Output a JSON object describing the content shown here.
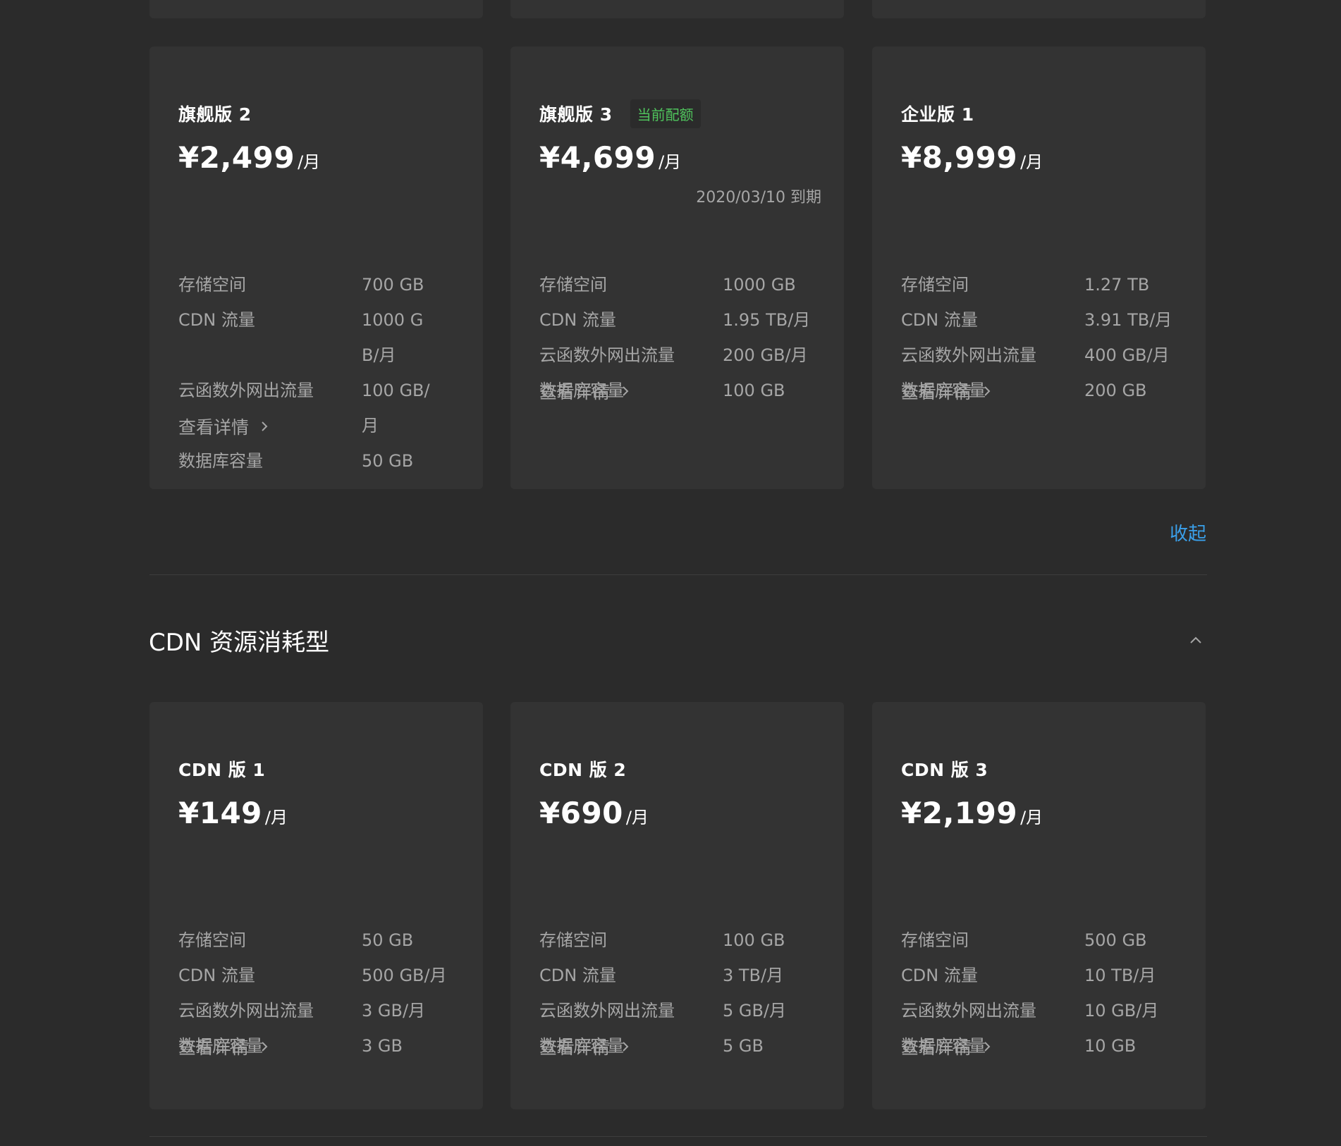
{
  "collapse_label": "收起",
  "section": {
    "title": "CDN 资源消耗型"
  },
  "spec_labels": {
    "storage": "存储空间",
    "cdn": "CDN 流量",
    "egress": "云函数外网出流量",
    "db": "数据库容量"
  },
  "details_label": "查看详情",
  "top_cards": [
    {
      "title": "旗舰版 2",
      "price": "¥2,499",
      "unit": "/月",
      "storage": "700 GB",
      "cdn": "1000 GB/月",
      "egress": "100 GB/月",
      "db": "50 GB"
    },
    {
      "title": "旗舰版 3",
      "badge": "当前配额",
      "price": "¥4,699",
      "unit": "/月",
      "expiry": "2020/03/10 到期",
      "storage": "1000 GB",
      "cdn": "1.95 TB/月",
      "egress": "200 GB/月",
      "db": "100 GB"
    },
    {
      "title": "企业版 1",
      "price": "¥8,999",
      "unit": "/月",
      "storage": "1.27 TB",
      "cdn": "3.91 TB/月",
      "egress": "400 GB/月",
      "db": "200 GB"
    }
  ],
  "cdn_cards": [
    {
      "title": "CDN 版 1",
      "price": "¥149",
      "unit": "/月",
      "storage": "50 GB",
      "cdn": "500 GB/月",
      "egress": "3 GB/月",
      "db": "3 GB"
    },
    {
      "title": "CDN 版 2",
      "price": "¥690",
      "unit": "/月",
      "storage": "100 GB",
      "cdn": "3 TB/月",
      "egress": "5 GB/月",
      "db": "5 GB"
    },
    {
      "title": "CDN 版 3",
      "price": "¥2,199",
      "unit": "/月",
      "storage": "500 GB",
      "cdn": "10 TB/月",
      "egress": "10 GB/月",
      "db": "10 GB"
    }
  ],
  "colors": {
    "background": "#2b2b2b",
    "card": "#333333",
    "muted_text": "#a6a6a6",
    "link": "#3aa0ea",
    "badge_text": "#4fc35c"
  }
}
